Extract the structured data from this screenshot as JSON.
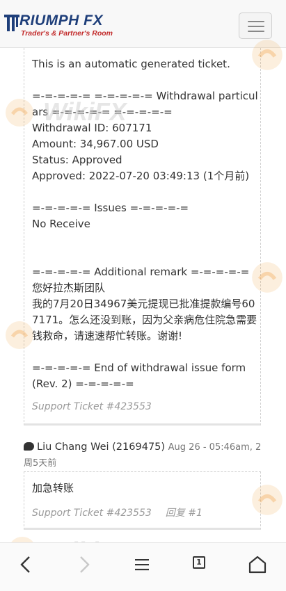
{
  "brand": {
    "name": "RIUMPH FX",
    "tagline": "Trader's & Partner's Room"
  },
  "ticket": {
    "body": "This is an automatic generated ticket.\n\n=-=-=-=-= =-=-=-=-= Withdrawal particulars =-=-=-=-= =-=-=-=-=\nWithdrawal ID: 607171\nAmount: 34,967.00 USD\nStatus: Approved\nApproved: 2022-07-20 03:49:13 (1个月前)\n\n=-=-=-=-= Issues =-=-=-=-=\nNo Receive\n\n\n=-=-=-=-= Additional remark =-=-=-=-=\n您好拉杰斯团队\n我的7月20日34967美元提现已批准提款编号607171。怎么还没到账，因为父亲病危住院急需要钱救命，请速速帮忙转账。谢谢!\n\n=-=-=-=-= End of withdrawal issue form (Rev. 2) =-=-=-=-=",
    "support_ticket": "Support Ticket #423553"
  },
  "reply": {
    "author": "Liu Chang Wei (2169475)",
    "when": "Aug 26 - 05:46am, 2周5天前",
    "text": "加急转账",
    "support_ticket": "Support Ticket #423553",
    "reply_no": "回复 #1"
  },
  "nav": {
    "tab_count": "1"
  },
  "watermark": {
    "text": "WikiFX"
  },
  "colors": {
    "brand_blue": "#1f3f7a",
    "brand_red": "#c22b2b",
    "watermark_orange": "#f0a44a"
  },
  "icons": [
    "menu-icon",
    "chat-icon",
    "back-icon",
    "forward-icon",
    "hamburger-icon",
    "tabs-icon",
    "home-icon"
  ]
}
